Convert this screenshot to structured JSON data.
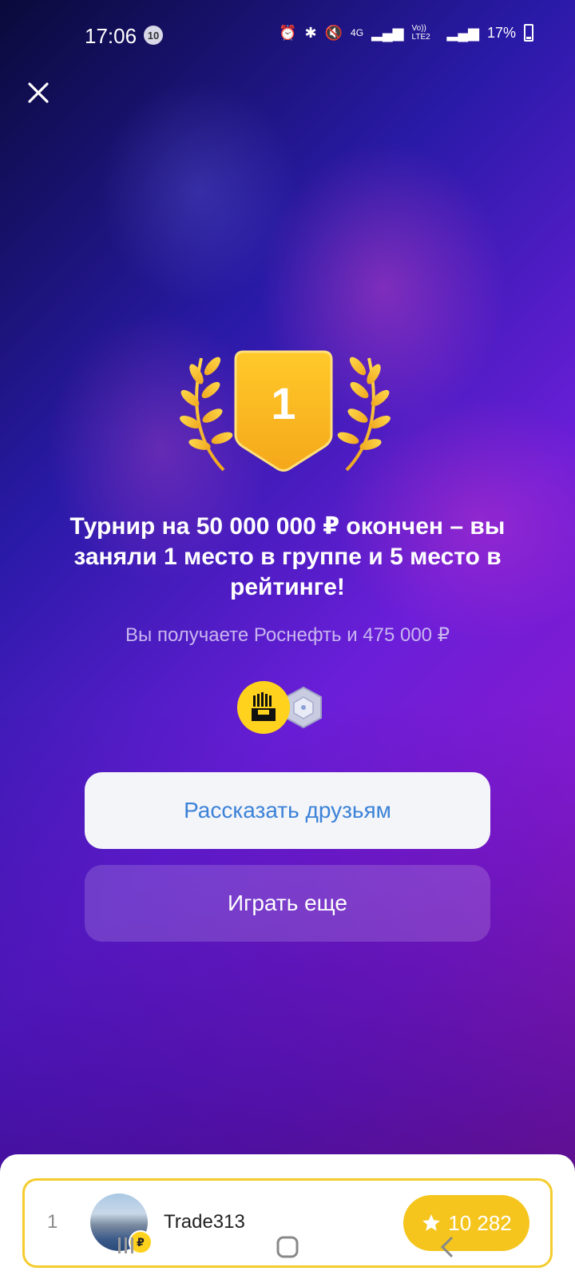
{
  "status_bar": {
    "time": "17:06",
    "notification_count": "10",
    "battery": "17%",
    "network_1": "4G",
    "network_2": "Vo)) LTE2"
  },
  "result": {
    "rank": "1",
    "headline": "Турнир на 50 000 000 ₽ окончен – вы заняли 1 место в группе и 5 место в рейтинге!",
    "reward": "Вы получаете Роснефть и 475 000 ₽"
  },
  "buttons": {
    "share": "Рассказать друзьям",
    "play_again": "Играть еще"
  },
  "player": {
    "rank": "1",
    "name": "Trade313",
    "score": "10 282",
    "avatar_coin": "₽"
  },
  "colors": {
    "accent_gold": "#f5c51e",
    "share_text": "#3b82d8",
    "highlight_border": "#f5cc2e"
  }
}
